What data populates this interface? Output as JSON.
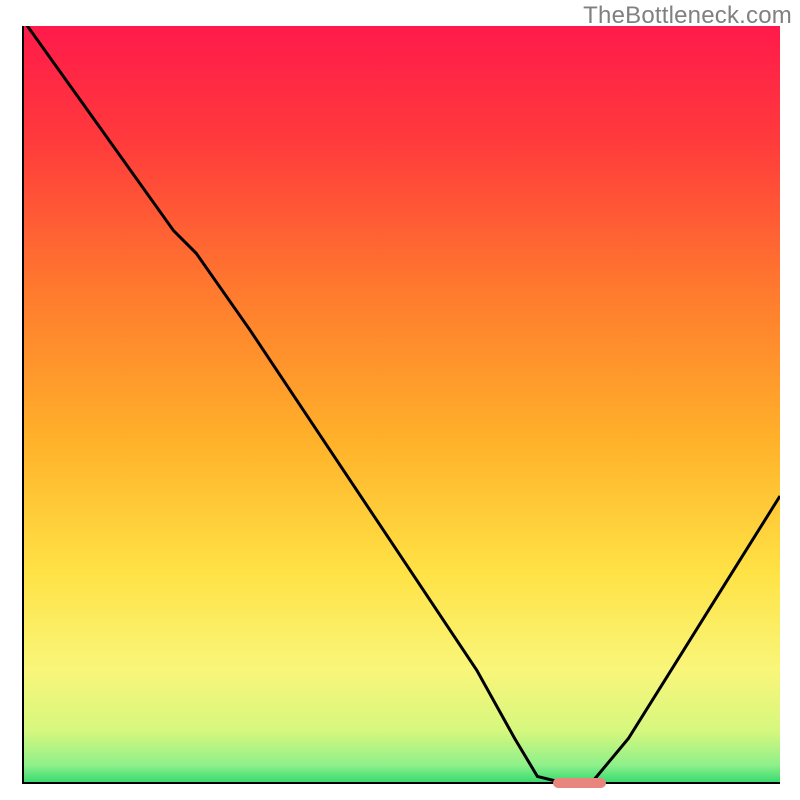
{
  "watermark": "TheBottleneck.com",
  "colors": {
    "axis": "#000000",
    "curve": "#000000",
    "marker": "#e9857f",
    "gradient_stops": [
      {
        "offset": 0.0,
        "color": "#ff1a4b"
      },
      {
        "offset": 0.15,
        "color": "#ff3a3c"
      },
      {
        "offset": 0.35,
        "color": "#ff7a2e"
      },
      {
        "offset": 0.55,
        "color": "#ffb22a"
      },
      {
        "offset": 0.72,
        "color": "#ffe245"
      },
      {
        "offset": 0.85,
        "color": "#f9f67a"
      },
      {
        "offset": 0.93,
        "color": "#d6f77e"
      },
      {
        "offset": 0.975,
        "color": "#8ff08a"
      },
      {
        "offset": 1.0,
        "color": "#2fd86e"
      }
    ]
  },
  "chart_data": {
    "type": "line",
    "title": "",
    "xlabel": "",
    "ylabel": "",
    "xlim": [
      0,
      100
    ],
    "ylim": [
      0,
      100
    ],
    "x": [
      0,
      5,
      10,
      15,
      20,
      23,
      30,
      40,
      50,
      60,
      65,
      68,
      72,
      75,
      80,
      85,
      90,
      95,
      100
    ],
    "values": [
      101,
      94,
      87,
      80,
      73,
      70,
      60,
      45,
      30,
      15,
      6,
      1,
      0,
      0,
      6,
      14,
      22,
      30,
      38
    ],
    "marker": {
      "x_start": 70,
      "x_end": 77,
      "y": 0
    }
  }
}
